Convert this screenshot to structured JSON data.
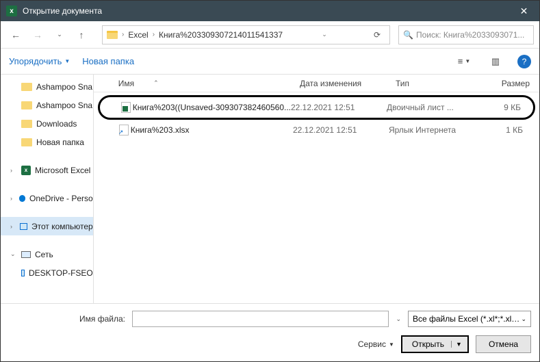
{
  "titlebar": {
    "title": "Открытие документа"
  },
  "nav": {
    "crumbs": [
      "Excel",
      "Книга%203309307214011541337"
    ],
    "search_placeholder": "Поиск: Книга%2033093071..."
  },
  "toolbar": {
    "organize": "Упорядочить",
    "new_folder": "Новая папка"
  },
  "tree": {
    "items": [
      {
        "label": "Ashampoo Sna",
        "kind": "folder",
        "indent": true
      },
      {
        "label": "Ashampoo Sna",
        "kind": "folder",
        "indent": true
      },
      {
        "label": "Downloads",
        "kind": "folder",
        "indent": true
      },
      {
        "label": "Новая папка",
        "kind": "folder",
        "indent": true
      }
    ],
    "groups": [
      {
        "label": "Microsoft Excel",
        "kind": "excel",
        "expand": ">"
      },
      {
        "label": "OneDrive - Perso",
        "kind": "onedrive",
        "expand": ">"
      },
      {
        "label": "Этот компьютер",
        "kind": "pc",
        "expand": ">",
        "selected": true
      },
      {
        "label": "Сеть",
        "kind": "network",
        "expand": "v"
      }
    ],
    "network_child": {
      "label": "DESKTOP-FSEO",
      "kind": "pc"
    }
  },
  "columns": {
    "name": "Имя",
    "date": "Дата изменения",
    "type": "Тип",
    "size": "Размер"
  },
  "files": [
    {
      "name": "Книга%203((Unsaved-309307382460560...",
      "date": "22.12.2021 12:51",
      "type": "Двоичный лист ...",
      "size": "9 КБ",
      "icon": "xlsb",
      "highlighted": true
    },
    {
      "name": "Книга%203.xlsx",
      "date": "22.12.2021 12:51",
      "type": "Ярлык Интернета",
      "size": "1 КБ",
      "icon": "link",
      "highlighted": false
    }
  ],
  "footer": {
    "filename_label": "Имя файла:",
    "filename_value": "",
    "filter": "Все файлы Excel (*.xl*;*.xlsx;*",
    "tools": "Сервис",
    "open": "Открыть",
    "cancel": "Отмена"
  }
}
